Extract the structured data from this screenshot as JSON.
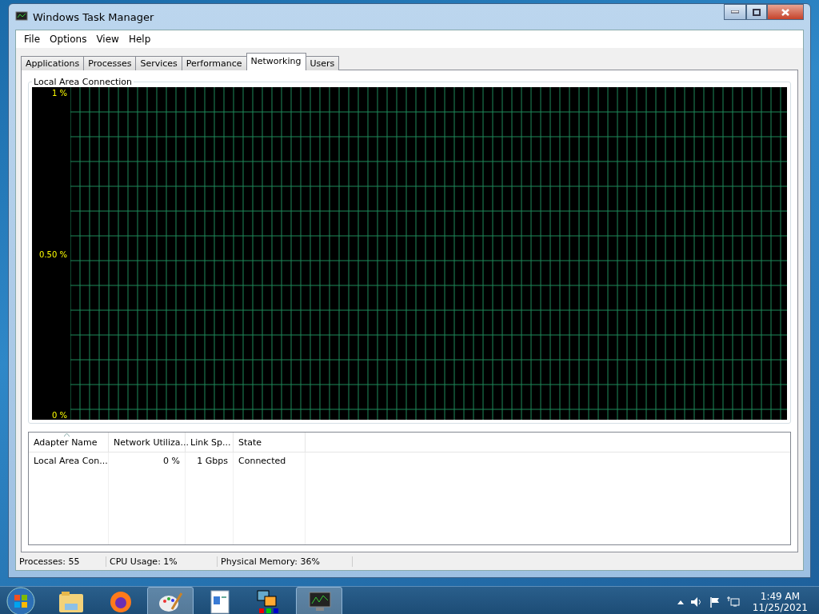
{
  "window": {
    "title": "Windows Task Manager"
  },
  "menu": [
    "File",
    "Options",
    "View",
    "Help"
  ],
  "tabs": [
    {
      "label": "Applications",
      "selected": false
    },
    {
      "label": "Processes",
      "selected": false
    },
    {
      "label": "Services",
      "selected": false
    },
    {
      "label": "Performance",
      "selected": false
    },
    {
      "label": "Networking",
      "selected": true
    },
    {
      "label": "Users",
      "selected": false
    }
  ],
  "graph": {
    "title": "Local Area Connection",
    "axis_labels": [
      "1 %",
      "0.50 %",
      "0 %"
    ]
  },
  "adapters": {
    "columns": [
      {
        "label": "Adapter Name",
        "sorted": true
      },
      {
        "label": "Network Utiliza...",
        "sorted": false
      },
      {
        "label": "Link Sp...",
        "sorted": false
      },
      {
        "label": "State",
        "sorted": false
      }
    ],
    "rows": [
      [
        "Local Area Con...",
        "0 %",
        "1 Gbps",
        "Connected"
      ]
    ]
  },
  "status_bar": [
    "Processes: 55",
    "CPU Usage: 1%",
    "Physical Memory: 36%"
  ],
  "taskbar": {
    "apps": [
      {
        "kind": "folder",
        "active": false
      },
      {
        "kind": "browser",
        "active": false
      },
      {
        "kind": "paint",
        "active": true
      },
      {
        "kind": "document",
        "active": false
      },
      {
        "kind": "pictures",
        "active": false
      },
      {
        "kind": "monitor",
        "active": true
      }
    ],
    "time": "1:49 AM",
    "date": "11/25/2021"
  }
}
